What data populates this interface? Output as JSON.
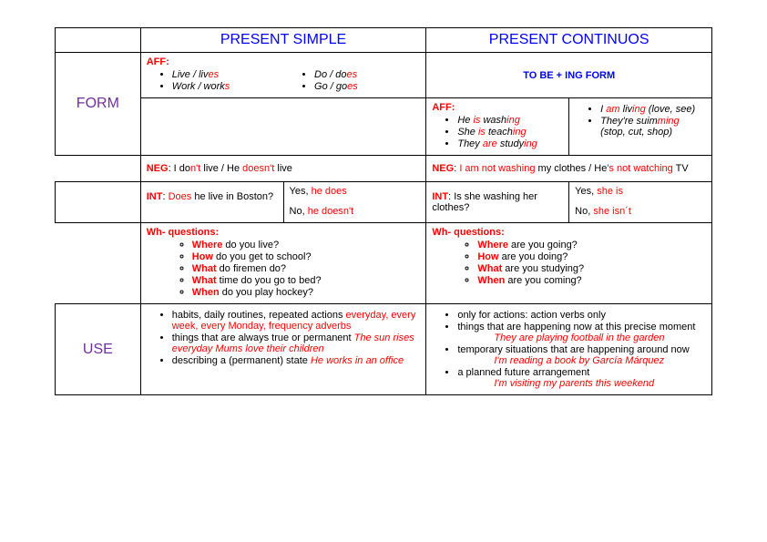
{
  "headers": {
    "left": "PRESENT SIMPLE",
    "right": "PRESENT CONTINUOS",
    "form": "FORM",
    "use": "USE",
    "tobe": "TO BE + ING FORM"
  },
  "aff": {
    "label": "AFF:",
    "ps_col1_a": "Live / liv",
    "ps_col1_a_end": "es",
    "ps_col1_b": "Work / work",
    "ps_col1_b_end": "s",
    "ps_col2_a": "Do / do",
    "ps_col2_a_end": "es",
    "ps_col2_b": "Go / go",
    "ps_col2_b_end": "es",
    "pc_col1_a_pre": "He ",
    "pc_col1_a_aux": "is",
    "pc_col1_a_mid": " wash",
    "pc_col1_a_end": "ing",
    "pc_col1_b_pre": "She ",
    "pc_col1_b_aux": "is",
    "pc_col1_b_mid": " teach",
    "pc_col1_b_end": "ing",
    "pc_col1_c_pre": "They ",
    "pc_col1_c_aux": "are",
    "pc_col1_c_mid": " study",
    "pc_col1_c_end": "ing",
    "pc_col2_a_pre": "I ",
    "pc_col2_a_aux": "am",
    "pc_col2_a_mid": " liv",
    "pc_col2_a_end": "ing",
    "pc_col2_a_tail": " (love, see)",
    "pc_col2_b_pre": "They're suim",
    "pc_col2_b_end": "ming",
    "pc_col2_b_tail": " (stop, cut, shop)"
  },
  "neg": {
    "label": "NEG",
    "ps_a": ": I do",
    "ps_b": "n't",
    "ps_c": " live / He ",
    "ps_d": "doesn't",
    "ps_e": " live",
    "pc_a": ": ",
    "pc_b": "I am not washing",
    "pc_c": " my clothes / He",
    "pc_d": "'s not watching",
    "pc_e": " TV"
  },
  "int": {
    "label": "INT",
    "ps_q_a": ": ",
    "ps_q_b": "Does",
    "ps_q_c": " he live in Boston?",
    "ps_a1_a": "Yes, ",
    "ps_a1_b": "he does",
    "ps_a2_a": "No, ",
    "ps_a2_b": "he doesn't",
    "pc_q": ": Is she washing her clothes?",
    "pc_a1_a": "Yes, ",
    "pc_a1_b": "she is",
    "pc_a2_a": "No, ",
    "pc_a2_b": "she isn´t"
  },
  "wh": {
    "label": "Wh- questions:",
    "ps": [
      {
        "w": "Where",
        "t": " do you live?"
      },
      {
        "w": "How",
        "t": " do you get to school?"
      },
      {
        "w": "What",
        "t": " do firemen do?"
      },
      {
        "w": "What",
        "t": " time do you go to bed?"
      },
      {
        "w": "When",
        "t": " do you play hockey?"
      }
    ],
    "pc": [
      {
        "w": "Where",
        "t": " are you going?"
      },
      {
        "w": "How",
        "t": " are you doing?"
      },
      {
        "w": "What",
        "t": " are you studying?"
      },
      {
        "w": "When",
        "t": " are you coming?"
      }
    ]
  },
  "use": {
    "ps": {
      "i1_a": "habits, daily routines, repeated actions ",
      "i1_b": "everyday, every week, every Monday, frequency adverbs",
      "i2_a": "things that are always true or permanent ",
      "i2_b": "The sun rises everyday Mums love their children",
      "i3_a": "describing a (permanent) state ",
      "i3_b": "He works in an office"
    },
    "pc": {
      "i1": "only for actions: action verbs only",
      "i2": "things that are happening now at this precise moment",
      "i2_ex": "They are playing football in the garden",
      "i3": "temporary situations that are happening around now",
      "i3_ex": "I'm reading a book by García Márquez",
      "i4": "a planned future arrangement",
      "i4_ex": "I'm visiting my parents this weekend"
    }
  }
}
